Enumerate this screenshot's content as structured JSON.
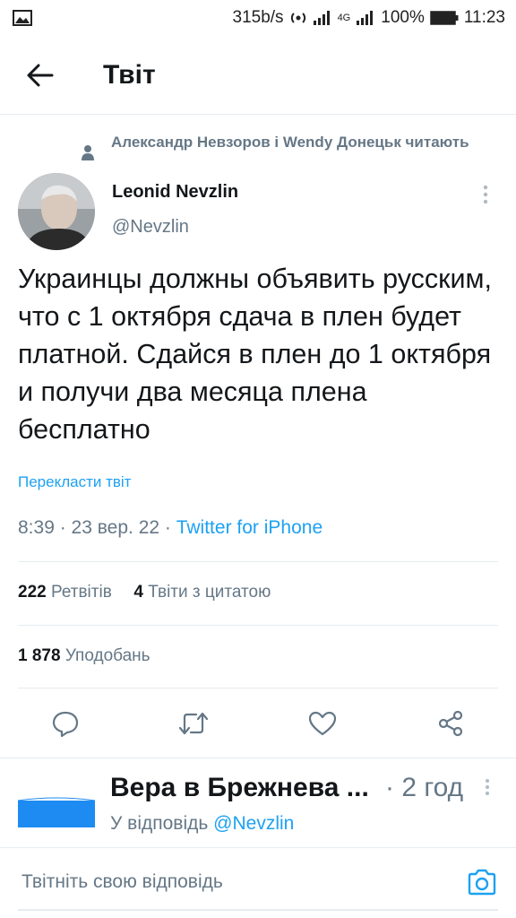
{
  "status_bar": {
    "speed": "315b/s",
    "network": "4G",
    "battery": "100%",
    "time": "11:23"
  },
  "header": {
    "title": "Твіт"
  },
  "tweet": {
    "social_context": "Александр Невзоров і Wendy Донецьк читають",
    "author_name": "Leonid Nevzlin",
    "author_handle": "@Nevzlin",
    "text": "Украинцы должны объявить русским, что с 1 октября сдача в плен будет платной. Сдайся в плен до 1 октября и получи два месяца плена бесплатно",
    "translate_label": "Перекласти твіт",
    "time": "8:39",
    "date": "23 вер. 22",
    "source": "Twitter for iPhone",
    "retweets_count": "222",
    "retweets_label": "Ретвітів",
    "quotes_count": "4",
    "quotes_label": "Твіти з цитатою",
    "likes_count": "1 878",
    "likes_label": "Уподобань"
  },
  "reply": {
    "name": "Вера в Брежнева ...",
    "time": "2 год",
    "reply_to_prefix": "У відповідь",
    "reply_to_handle": "@Nevzlin"
  },
  "compose": {
    "placeholder": "Твітніть свою відповідь"
  },
  "colors": {
    "accent": "#1da1f2",
    "text_primary": "#14171a",
    "text_secondary": "#657786",
    "divider": "#e6ecf0"
  },
  "icons": {
    "back": "arrow-left-icon",
    "more": "more-vertical-icon",
    "reply": "comment-icon",
    "retweet": "retweet-icon",
    "like": "heart-icon",
    "share": "share-icon",
    "camera": "camera-icon"
  }
}
